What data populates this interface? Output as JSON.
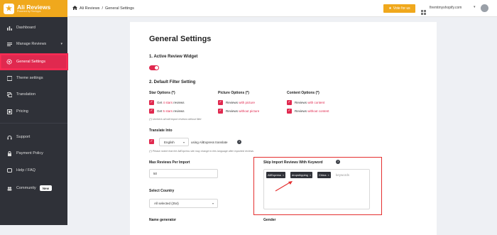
{
  "app": {
    "title": "Ali Reviews",
    "subtitle": "Powered by FireApps"
  },
  "sidebar": {
    "items": [
      {
        "label": "Dashboard",
        "icon": "bar-chart-icon"
      },
      {
        "label": "Manage Reviews",
        "icon": "star-list-icon"
      },
      {
        "label": "General Settings",
        "icon": "gear-icon"
      },
      {
        "label": "Theme settings",
        "icon": "palette-icon"
      },
      {
        "label": "Translation",
        "icon": "translate-icon"
      },
      {
        "label": "Pricing",
        "icon": "pricing-icon"
      },
      {
        "label": "Support",
        "icon": "headset-icon"
      },
      {
        "label": "Payment Policy",
        "icon": "lock-icon"
      },
      {
        "label": "Help / FAQ",
        "icon": "help-icon"
      },
      {
        "label": "Community",
        "icon": "community-icon",
        "badge": "New"
      }
    ]
  },
  "topbar": {
    "breadcrumb": [
      "Ali Reviews",
      "General Settings"
    ],
    "vote_label": "Vote for us",
    "store": "firemtmyshopify.com"
  },
  "settings": {
    "title": "General Settings",
    "section1": "1. Active Review Widget",
    "section2": "2. Default Filter Setting",
    "star_options": {
      "title": "Star Options (*)",
      "items": [
        {
          "pre": "Get ",
          "hl": "4 stars",
          "post": " reviews"
        },
        {
          "pre": "Get ",
          "hl": "5 stars",
          "post": " reviews"
        }
      ],
      "note": "(*) Uncheck all will import reviews without filter"
    },
    "picture_options": {
      "title": "Picture Options (*)",
      "items": [
        {
          "pre": "Reviews ",
          "hl": "with picture",
          "post": ""
        },
        {
          "pre": "Reviews ",
          "hl": "without picture",
          "post": ""
        }
      ]
    },
    "content_options": {
      "title": "Content Options (*)",
      "items": [
        {
          "pre": "Reviews ",
          "hl": "with content",
          "post": ""
        },
        {
          "pre": "Reviews ",
          "hl": "without content",
          "post": ""
        }
      ]
    },
    "translate": {
      "title": "Translate Into",
      "language": "English",
      "using": "using AliExpress translate",
      "note": "(*) Please notice that the AliExpress site may change to this language after imported reviews"
    },
    "max_reviews": {
      "label": "Max Reviews Per Import",
      "value": "50"
    },
    "skip_keywords": {
      "label": "Skip Import Reviews With Keyword",
      "tags": [
        "AliExpress",
        "dropshipping",
        "China"
      ],
      "placeholder": "keywords"
    },
    "country": {
      "label": "Select Country",
      "value": "All selected (254)"
    },
    "name_generator": {
      "label": "Name generator"
    },
    "gender": {
      "label": "Gender"
    }
  },
  "colors": {
    "accent": "#e0294f",
    "brand": "#f0a81c",
    "sidebar_bg": "#2f3138"
  }
}
